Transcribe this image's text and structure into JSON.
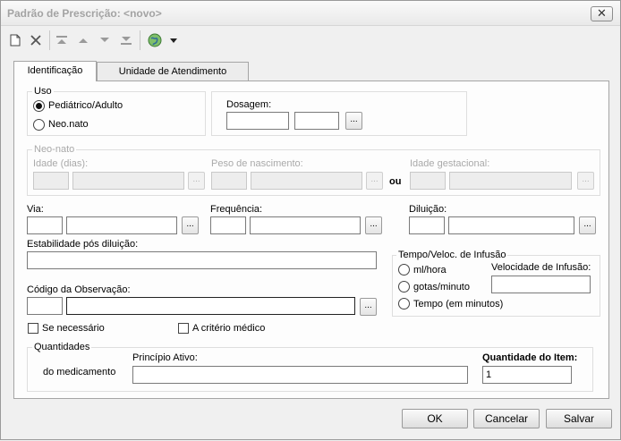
{
  "window": {
    "title": "Padrão de Prescrição: <novo>",
    "close_label": "✕"
  },
  "toolbar": {
    "icons": [
      "new-document-icon",
      "delete-icon",
      "move-first-icon",
      "move-up-icon",
      "move-down-icon",
      "move-last-icon",
      "globe-icon",
      "dropdown-arrow-icon"
    ]
  },
  "tabs": [
    {
      "label": "Identificação",
      "active": true
    },
    {
      "label": "Unidade de Atendimento",
      "active": false
    }
  ],
  "uso": {
    "label": "Uso",
    "options": [
      {
        "label": "Pediátrico/Adulto",
        "selected": true
      },
      {
        "label": "Neo.nato",
        "selected": false
      }
    ]
  },
  "dosagem": {
    "label": "Dosagem:",
    "value1": "",
    "value2": "",
    "lookup": "..."
  },
  "neonato": {
    "label": "Neo-nato",
    "idade_label": "Idade (dias):",
    "peso_label": "Peso de nascimento:",
    "ou_label": "ou",
    "idade_gest_label": "Idade gestacional:"
  },
  "via": {
    "label": "Via:",
    "lookup": "..."
  },
  "frequencia": {
    "label": "Frequência:",
    "lookup": "..."
  },
  "diluicao": {
    "label": "Diluição:",
    "lookup": "..."
  },
  "estabilidade": {
    "label": "Estabilidade pós diluição:",
    "value": ""
  },
  "infusao": {
    "label": "Tempo/Veloc. de Infusão",
    "options": [
      {
        "label": "ml/hora",
        "selected": false
      },
      {
        "label": "gotas/minuto",
        "selected": false
      },
      {
        "label": "Tempo (em minutos)",
        "selected": false
      }
    ],
    "velocidade_label": "Velocidade de Infusão:",
    "velocidade_value": ""
  },
  "observacao": {
    "label": "Código da Observação:",
    "lookup": "..."
  },
  "checkboxes": {
    "se_necessario": "Se necessário",
    "criterio_medico": "A critério médico"
  },
  "quantidades": {
    "label": "Quantidades",
    "sub_label": "do medicamento",
    "principio_label": "Princípio Ativo:",
    "principio_value": "",
    "qtd_label": "Quantidade do Item:",
    "qtd_value": "1"
  },
  "footer": {
    "ok": "OK",
    "cancel": "Cancelar",
    "save": "Salvar"
  }
}
